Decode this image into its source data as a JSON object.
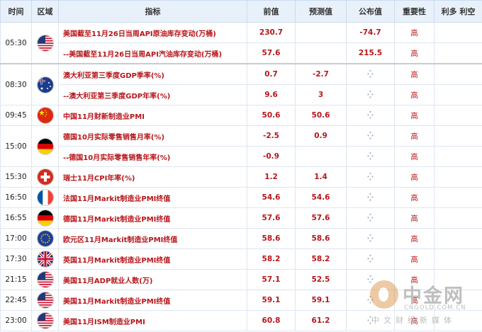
{
  "headers": [
    "时间",
    "区域",
    "指标",
    "前值",
    "预测值",
    "公布值",
    "重要性",
    "利多 利空"
  ],
  "rows": [
    {
      "time": "05:30",
      "flag": "us",
      "indicator": "美国截至11月26日当周API原油库存变动(万桶)",
      "prev": "230.7",
      "forecast": "",
      "actual": "-74.7",
      "importance": "高",
      "effect": ""
    },
    {
      "time": "",
      "flag": "",
      "indicator": "--美国截至11月26日当周API汽油库存变动(万桶)",
      "prev": "57.6",
      "forecast": "",
      "actual": "215.5",
      "importance": "高",
      "effect": ""
    },
    {
      "time": "08:30",
      "flag": "au",
      "indicator": "澳大利亚第三季度GDP季率(%)",
      "prev": "0.7",
      "forecast": "-2.7",
      "actual": "",
      "importance": "高",
      "effect": ""
    },
    {
      "time": "",
      "flag": "",
      "indicator": "--澳大利亚第三季度GDP年率(%)",
      "prev": "9.6",
      "forecast": "3",
      "actual": "",
      "importance": "高",
      "effect": ""
    },
    {
      "time": "09:45",
      "flag": "cn",
      "indicator": "中国11月财新制造业PMI",
      "prev": "50.6",
      "forecast": "50.6",
      "actual": "",
      "importance": "高",
      "effect": ""
    },
    {
      "time": "15:00",
      "flag": "de",
      "indicator": "德国10月实际零售销售月率(%)",
      "prev": "-2.5",
      "forecast": "0.9",
      "actual": "",
      "importance": "高",
      "effect": ""
    },
    {
      "time": "",
      "flag": "",
      "indicator": "--德国10月实际零售销售年率(%)",
      "prev": "-0.9",
      "forecast": "",
      "actual": "",
      "importance": "高",
      "effect": ""
    },
    {
      "time": "15:30",
      "flag": "ch",
      "indicator": "瑞士11月CPI年率(%)",
      "prev": "1.2",
      "forecast": "1.4",
      "actual": "",
      "importance": "高",
      "effect": ""
    },
    {
      "time": "16:50",
      "flag": "fr",
      "indicator": "法国11月Markit制造业PMI终值",
      "prev": "54.6",
      "forecast": "54.6",
      "actual": "",
      "importance": "高",
      "effect": ""
    },
    {
      "time": "16:55",
      "flag": "de",
      "indicator": "德国11月Markit制造业PMI终值",
      "prev": "57.6",
      "forecast": "57.6",
      "actual": "",
      "importance": "高",
      "effect": ""
    },
    {
      "time": "17:00",
      "flag": "eu",
      "indicator": "欧元区11月Markit制造业PMI终值",
      "prev": "58.6",
      "forecast": "58.6",
      "actual": "",
      "importance": "高",
      "effect": ""
    },
    {
      "time": "17:30",
      "flag": "gb",
      "indicator": "英国11月Markit制造业PMI终值",
      "prev": "58.2",
      "forecast": "58.2",
      "actual": "",
      "importance": "高",
      "effect": ""
    },
    {
      "time": "21:15",
      "flag": "us",
      "indicator": "美国11月ADP就业人数(万)",
      "prev": "57.1",
      "forecast": "52.5",
      "actual": "",
      "importance": "高",
      "effect": ""
    },
    {
      "time": "22:45",
      "flag": "us",
      "indicator": "美国11月Markit制造业PMI终值",
      "prev": "59.1",
      "forecast": "59.1",
      "actual": "",
      "importance": "高",
      "effect": ""
    },
    {
      "time": "23:00",
      "flag": "us",
      "indicator": "美国11月ISM制造业PMI",
      "prev": "60.8",
      "forecast": "61.2",
      "actual": "",
      "importance": "高",
      "effect": ""
    }
  ],
  "watermark": {
    "name": "中金网",
    "site": "CNGOLD.COM.CN",
    "slogan": "中文财经新媒体"
  }
}
